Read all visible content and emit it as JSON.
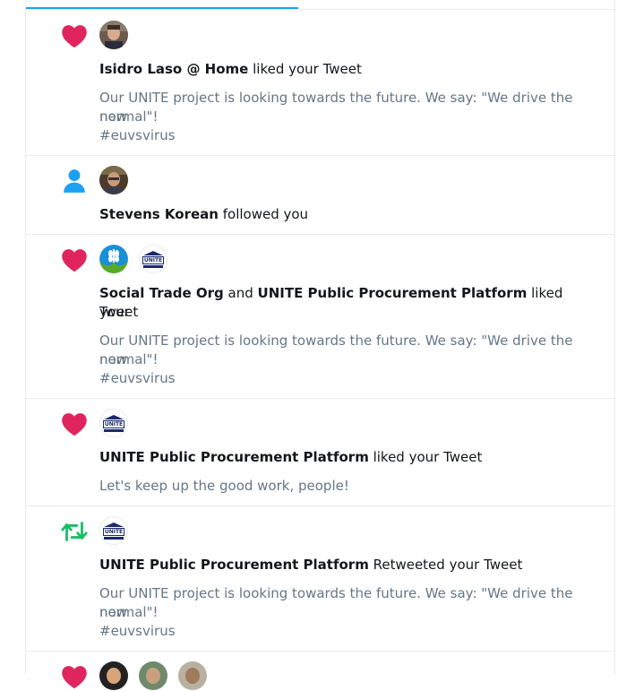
{
  "colors": {
    "like": "#e0245e",
    "follow": "#1da1f2",
    "retweet": "#17bf63",
    "muted_text": "#657786",
    "border": "#e6ecf0"
  },
  "notifications": [
    {
      "type": "like",
      "icon": "heart-icon",
      "actor": "Isidro Laso @ Home",
      "action": " liked your Tweet",
      "tweet_line1": "Our UNITE project is looking towards the future. We say: \"We drive the new",
      "tweet_line2": "normal\"!",
      "tweet_line3": "#euvsvirus"
    },
    {
      "type": "follow",
      "icon": "person-icon",
      "actor": "Stevens Korean",
      "action": " followed you"
    },
    {
      "type": "like",
      "icon": "heart-icon",
      "actor": "Social Trade Org",
      "conj": " and ",
      "actor2": "UNITE Public Procurement Platform",
      "action": " liked your",
      "action_line2": "Tweet",
      "tweet_line1": "Our UNITE project is looking towards the future. We say: \"We drive the new",
      "tweet_line2": "normal\"!",
      "tweet_line3": "#euvsvirus"
    },
    {
      "type": "like",
      "icon": "heart-icon",
      "actor": "UNITE Public Procurement Platform",
      "action": " liked your Tweet",
      "tweet_line1": "Let's keep up the good work, people!"
    },
    {
      "type": "retweet",
      "icon": "retweet-icon",
      "actor": "UNITE Public Procurement Platform",
      "action": " Retweeted your Tweet",
      "tweet_line1": "Our UNITE project is looking towards the future. We say: \"We drive the new",
      "tweet_line2": "normal\"!",
      "tweet_line3": "#euvsvirus"
    },
    {
      "type": "like",
      "icon": "heart-icon"
    }
  ],
  "logo_text": "UNITE"
}
